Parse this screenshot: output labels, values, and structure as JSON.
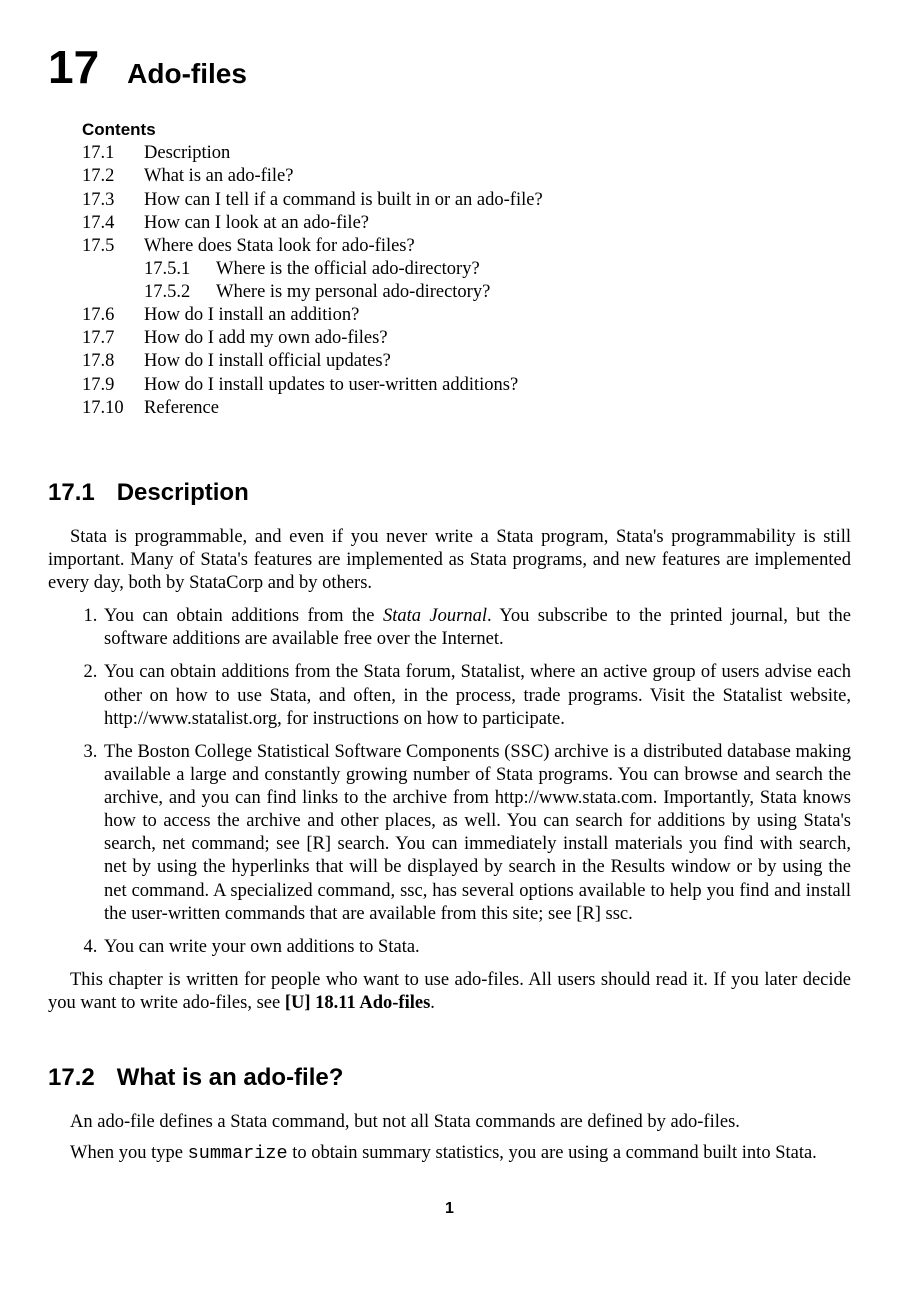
{
  "chapter": {
    "number": "17",
    "title": "Ado-files"
  },
  "contents_label": "Contents",
  "toc": [
    {
      "num": "17.1",
      "title": "Description"
    },
    {
      "num": "17.2",
      "title": "What is an ado-file?"
    },
    {
      "num": "17.3",
      "title": "How can I tell if a command is built in or an ado-file?"
    },
    {
      "num": "17.4",
      "title": "How can I look at an ado-file?"
    },
    {
      "num": "17.5",
      "title": "Where does Stata look for ado-files?",
      "subs": [
        {
          "num": "17.5.1",
          "title": "Where is the official ado-directory?"
        },
        {
          "num": "17.5.2",
          "title": "Where is my personal ado-directory?"
        }
      ]
    },
    {
      "num": "17.6",
      "title": "How do I install an addition?"
    },
    {
      "num": "17.7",
      "title": "How do I add my own ado-files?"
    },
    {
      "num": "17.8",
      "title": "How do I install official updates?"
    },
    {
      "num": "17.9",
      "title": "How do I install updates to user-written additions?"
    },
    {
      "num": "17.10",
      "title": "Reference"
    }
  ],
  "sec1": {
    "num": "17.1",
    "title": "Description",
    "p1": "Stata is programmable, and even if you never write a Stata program, Stata's programmability is still important. Many of Stata's features are implemented as Stata programs, and new features are implemented every day, both by StataCorp and by others.",
    "li1a": "You can obtain additions from the ",
    "li1_em": "Stata Journal",
    "li1b": ". You subscribe to the printed journal, but the software additions are available free over the Internet.",
    "li2": "You can obtain additions from the Stata forum, Statalist, where an active group of users advise each other on how to use Stata, and often, in the process, trade programs. Visit the Statalist website, http://www.statalist.org, for instructions on how to participate.",
    "li3": "The Boston College Statistical Software Components (SSC) archive is a distributed database making available a large and constantly growing number of Stata programs. You can browse and search the archive, and you can find links to the archive from http://www.stata.com. Importantly, Stata knows how to access the archive and other places, as well. You can search for additions by using Stata's search, net command; see [R] search. You can immediately install materials you find with search, net by using the hyperlinks that will be displayed by search in the Results window or by using the net command. A specialized command, ssc, has several options available to help you find and install the user-written commands that are available from this site; see [R] ssc.",
    "li4": "You can write your own additions to Stata.",
    "p2a": "This chapter is written for people who want to use ado-files. All users should read it. If you later decide you want to write ado-files, see ",
    "p2_ref": "[U] 18.11 Ado-files",
    "p2b": "."
  },
  "sec2": {
    "num": "17.2",
    "title": "What is an ado-file?",
    "p1": "An ado-file defines a Stata command, but not all Stata commands are defined by ado-files.",
    "p2a": "When you type ",
    "p2_tt": "summarize",
    "p2b": " to obtain summary statistics, you are using a command built into Stata."
  },
  "pagenum": "1"
}
